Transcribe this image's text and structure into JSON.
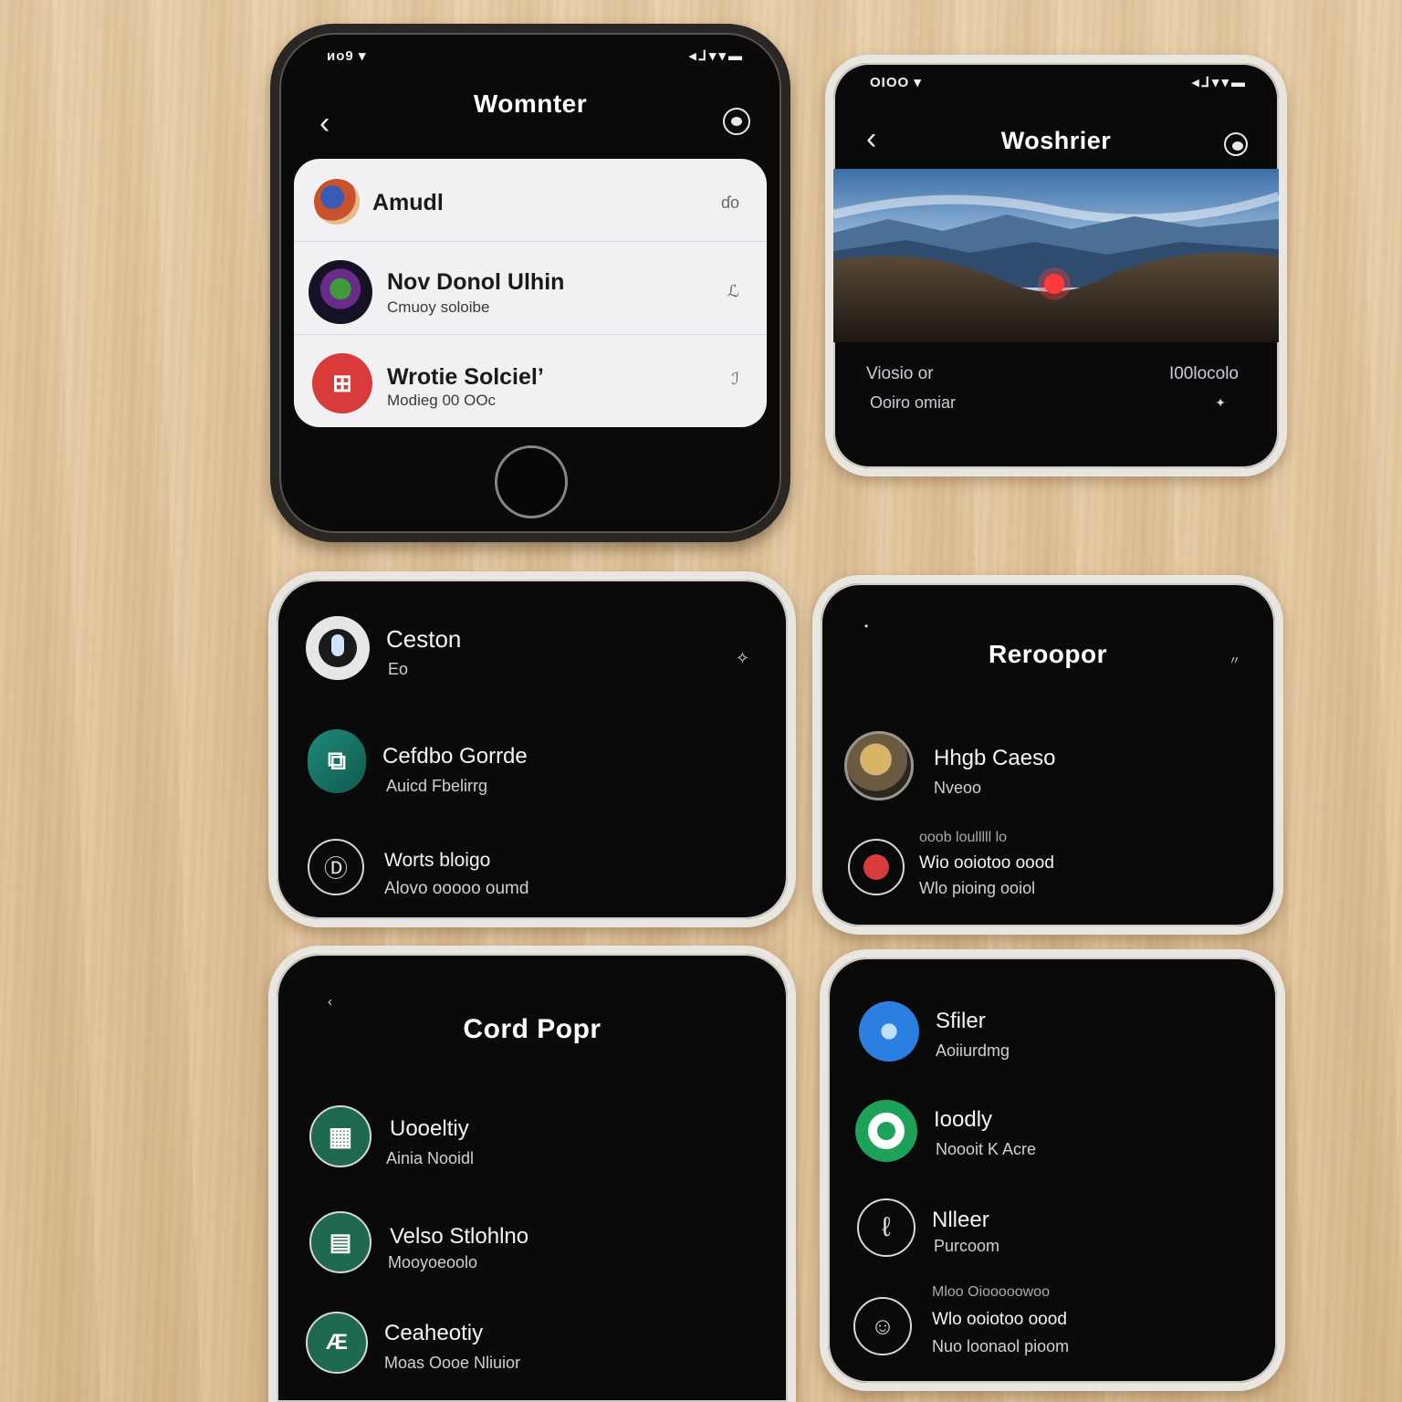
{
  "card1": {
    "status_left": "ᴎᴏ9 ▾",
    "status_right": "◂⅃▾▾▬",
    "title": "Womnter",
    "items": [
      {
        "title": "Amudl",
        "sub": "",
        "aux": "ɗo"
      },
      {
        "title": "Nov Donol Ulhin",
        "sub": "Cmuoy soloibe",
        "aux": "ℒ"
      },
      {
        "title": "Wrotie Solciel’",
        "sub": "Modieg 00 OOc",
        "aux": "ℐ"
      }
    ]
  },
  "card2": {
    "status_left": "OIOO ▾",
    "status_right": "◂⅃▾▾▬",
    "title": "Woshrier",
    "caption_left": "Viosio or",
    "caption_right": "I00locolo",
    "caption_sub": "Ooiro omiar"
  },
  "card3": {
    "items": [
      {
        "title": "Ceston",
        "sub": "Eo"
      },
      {
        "title": "Cefdbo Gorrde",
        "sub": "Auicd Fbelirrg"
      },
      {
        "title": "Worts bloigo",
        "sub": "Alovo ooooo oumd"
      }
    ]
  },
  "card4": {
    "title": "Reroopor",
    "items": [
      {
        "title": "Hhgb Caeso",
        "sub": "Nveoo"
      },
      {
        "title": "Wio ooiotoo oood",
        "sub": "Wlo pioing ooiol",
        "pre": "ooob loulllll lo"
      }
    ]
  },
  "card5": {
    "title": "Cord Popr",
    "items": [
      {
        "title": "Uooeltiy",
        "sub": "Ainia Nooidl"
      },
      {
        "title": "Velso Stlohlno",
        "sub": "Mooyoeoolo"
      },
      {
        "title": "Ceaheotiy",
        "sub": "Moas Oooe Nliuior"
      }
    ]
  },
  "card6": {
    "items": [
      {
        "title": "Sfiler",
        "sub": "Aoiiurdmg"
      },
      {
        "title": "Ioodly",
        "sub": "Noooit K Acre"
      },
      {
        "title": "Nlleer",
        "sub": "Purcoom"
      },
      {
        "title": "Wlo ooiotoo oood",
        "sub": "Nuo loonaol pioom",
        "pre": "Mloo Oiooooowoo"
      }
    ]
  },
  "colors": {
    "screen": "#0a0a0a",
    "list_bg": "#f1f1f3",
    "accent_red": "#d93a3a",
    "accent_green": "#1f7a5a",
    "accent_blue": "#2a7fe0"
  }
}
